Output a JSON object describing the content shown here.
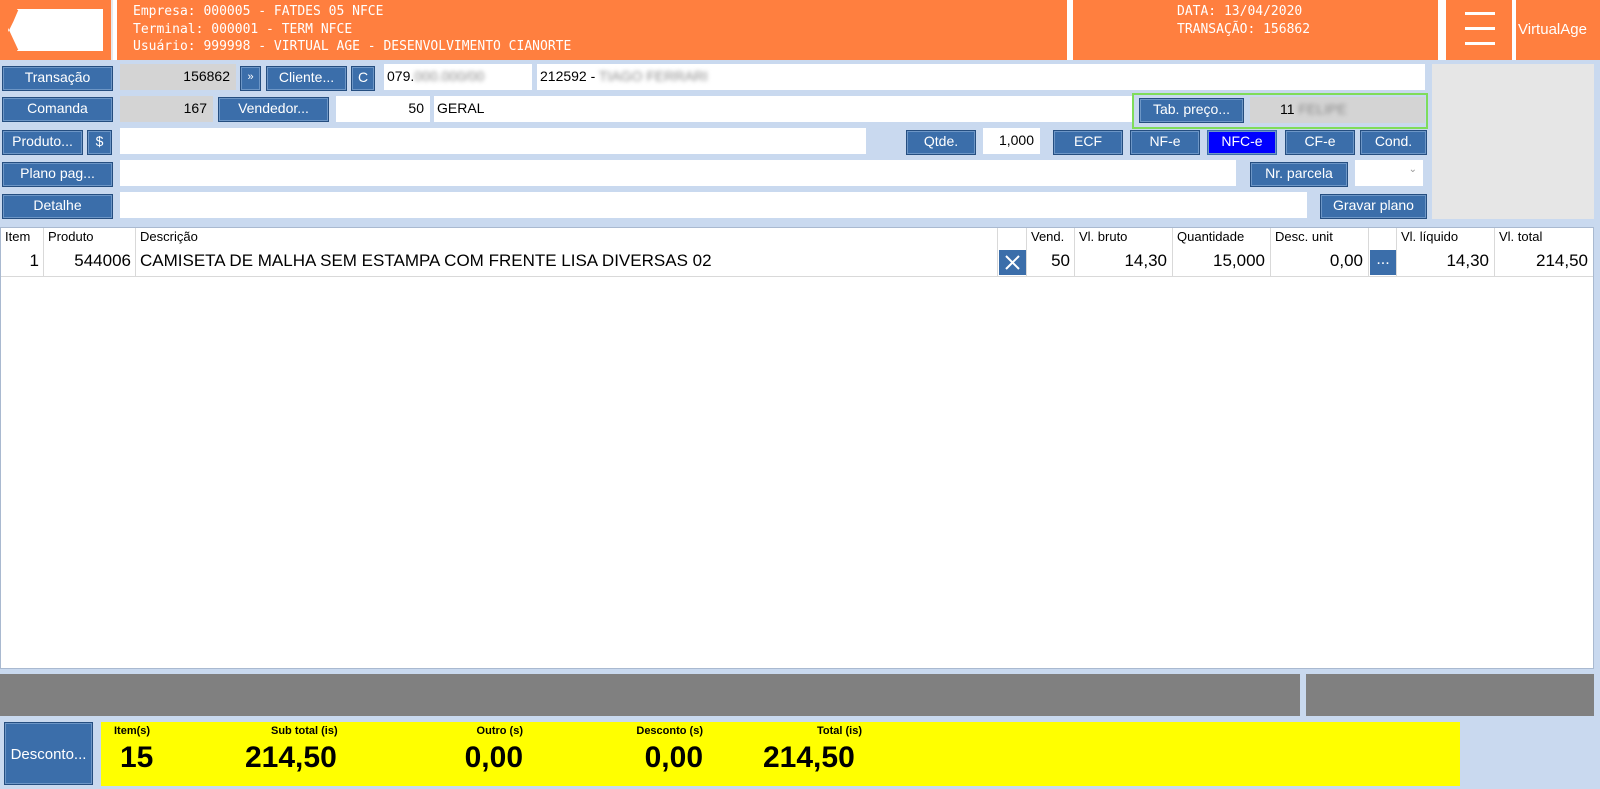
{
  "header": {
    "back_label": "Voltar",
    "empresa": "Empresa: 000005 - FATDES 05 NFCE",
    "terminal": "Terminal: 000001 - TERM NFCE",
    "usuario": "Usuário: 999998 - VIRTUAL AGE - DESENVOLVIMENTO CIANORTE",
    "data": "DATA: 13/04/2020",
    "transacao": "TRANSAÇÃO: 156862",
    "brand": "VirtualAge",
    "menu_icon": "hamburger-icon"
  },
  "form": {
    "transacao_label": "Transação",
    "transacao_value": "156862",
    "forward_glyph": "»",
    "cliente_label": "Cliente...",
    "cliente_c_label": "C",
    "cliente_doc": "079.",
    "cliente_doc_blurred": "000.000/00",
    "cliente_name_code": "212592 - ",
    "cliente_name_blurred": "TIAGO FERRARI",
    "comanda_label": "Comanda",
    "comanda_value": "167",
    "vendedor_label": "Vendedor...",
    "vendedor_code": "50",
    "vendedor_name": "GERAL",
    "tab_preco_label": "Tab. preço...",
    "tab_preco_code": "11",
    "tab_preco_name_blurred": "FELIPE",
    "produto_label": "Produto...",
    "dollar_label": "$",
    "qtde_label": "Qtde.",
    "qtde_value": "1,000",
    "ecf_label": "ECF",
    "nfe_label": "NF-e",
    "nfce_label": "NFC-e",
    "cfe_label": "CF-e",
    "cond_label": "Cond.",
    "plano_label": "Plano pag...",
    "nr_parcela_label": "Nr. parcela",
    "detalhe_label": "Detalhe",
    "gravar_label": "Gravar plano"
  },
  "table": {
    "headers": [
      "Item",
      "Produto",
      "Descrição",
      "",
      "Vend.",
      "Vl. bruto",
      "Quantidade",
      "Desc. unit",
      "",
      "Vl. líquido",
      "Vl. total"
    ],
    "rows": [
      {
        "item": "1",
        "produto": "544006",
        "descricao": "CAMISETA DE MALHA SEM ESTAMPA COM FRENTE LISA DIVERSAS 02",
        "remove_icon": "close-icon",
        "vend": "50",
        "vl_bruto": "14,30",
        "quantidade": "15,000",
        "desc_unit": "0,00",
        "more_glyph": "...",
        "vl_liquido": "14,30",
        "vl_total": "214,50"
      }
    ]
  },
  "footer": {
    "desconto_label": "Desconto...",
    "items_label": "Item(s)",
    "items_value": "15",
    "subtotal_label": "Sub total (is)",
    "subtotal_value": "214,50",
    "outro_label": "Outro (s)",
    "outro_value": "0,00",
    "desconto_t_label": "Desconto (s)",
    "desconto_t_value": "0,00",
    "total_label": "Total (is)",
    "total_value": "214,50"
  },
  "colors": {
    "header_orange": "#ff7f3f",
    "button_blue": "#3b6eaa",
    "active_blue": "#0000ff",
    "totals_yellow": "#ffff00",
    "highlight_green": "#7fdc5a"
  }
}
